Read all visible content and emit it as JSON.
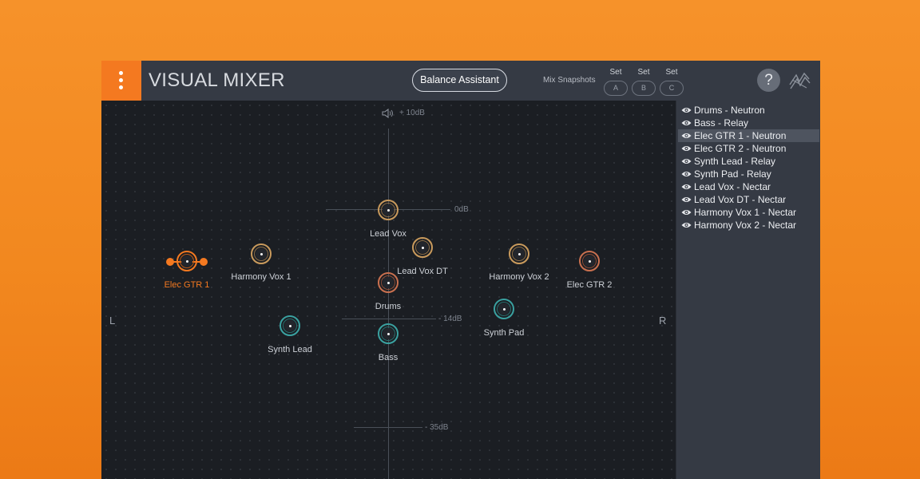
{
  "app": {
    "title": "VISUAL MIXER",
    "accent_color": "#f47920"
  },
  "toolbar": {
    "menu_icon": "vertical-dots-icon",
    "balance_label": "Balance Assistant",
    "snapshots_label": "Mix Snapshots",
    "set_labels": [
      "Set",
      "Set",
      "Set"
    ],
    "snapshot_buttons": [
      "A",
      "B",
      "C"
    ],
    "help_label": "?",
    "logo_icon": "izotope-logo"
  },
  "stage": {
    "volume_icon": "speaker-icon",
    "top_level": "+ 10dB",
    "marks": [
      "0dB",
      "- 14dB",
      "- 35dB"
    ],
    "left_label": "L",
    "right_label": "R",
    "nodes": [
      {
        "label": "Lead Vox",
        "color": "#c99a5c",
        "selected": false
      },
      {
        "label": "Lead Vox DT",
        "color": "#c99a5c",
        "selected": false
      },
      {
        "label": "Harmony Vox 1",
        "color": "#c99a5c",
        "selected": false
      },
      {
        "label": "Harmony Vox 2",
        "color": "#c99a5c",
        "selected": false
      },
      {
        "label": "Elec GTR 1",
        "color": "#f47920",
        "selected": true
      },
      {
        "label": "Elec GTR 2",
        "color": "#c9704f",
        "selected": false
      },
      {
        "label": "Drums",
        "color": "#c9704f",
        "selected": false
      },
      {
        "label": "Synth Lead",
        "color": "#3aa1a0",
        "selected": false
      },
      {
        "label": "Synth Pad",
        "color": "#3aa1a0",
        "selected": false
      },
      {
        "label": "Bass",
        "color": "#3aa1a0",
        "selected": false
      }
    ]
  },
  "tracks": [
    {
      "name": "Drums - Neutron",
      "selected": false
    },
    {
      "name": "Bass - Relay",
      "selected": false
    },
    {
      "name": "Elec GTR 1 - Neutron",
      "selected": true
    },
    {
      "name": "Elec GTR 2 - Neutron",
      "selected": false
    },
    {
      "name": "Synth Lead - Relay",
      "selected": false
    },
    {
      "name": "Synth Pad - Relay",
      "selected": false
    },
    {
      "name": "Lead Vox - Nectar",
      "selected": false
    },
    {
      "name": "Lead Vox DT - Nectar",
      "selected": false
    },
    {
      "name": "Harmony Vox 1 - Nectar",
      "selected": false
    },
    {
      "name": "Harmony Vox 2 - Nectar",
      "selected": false
    }
  ]
}
